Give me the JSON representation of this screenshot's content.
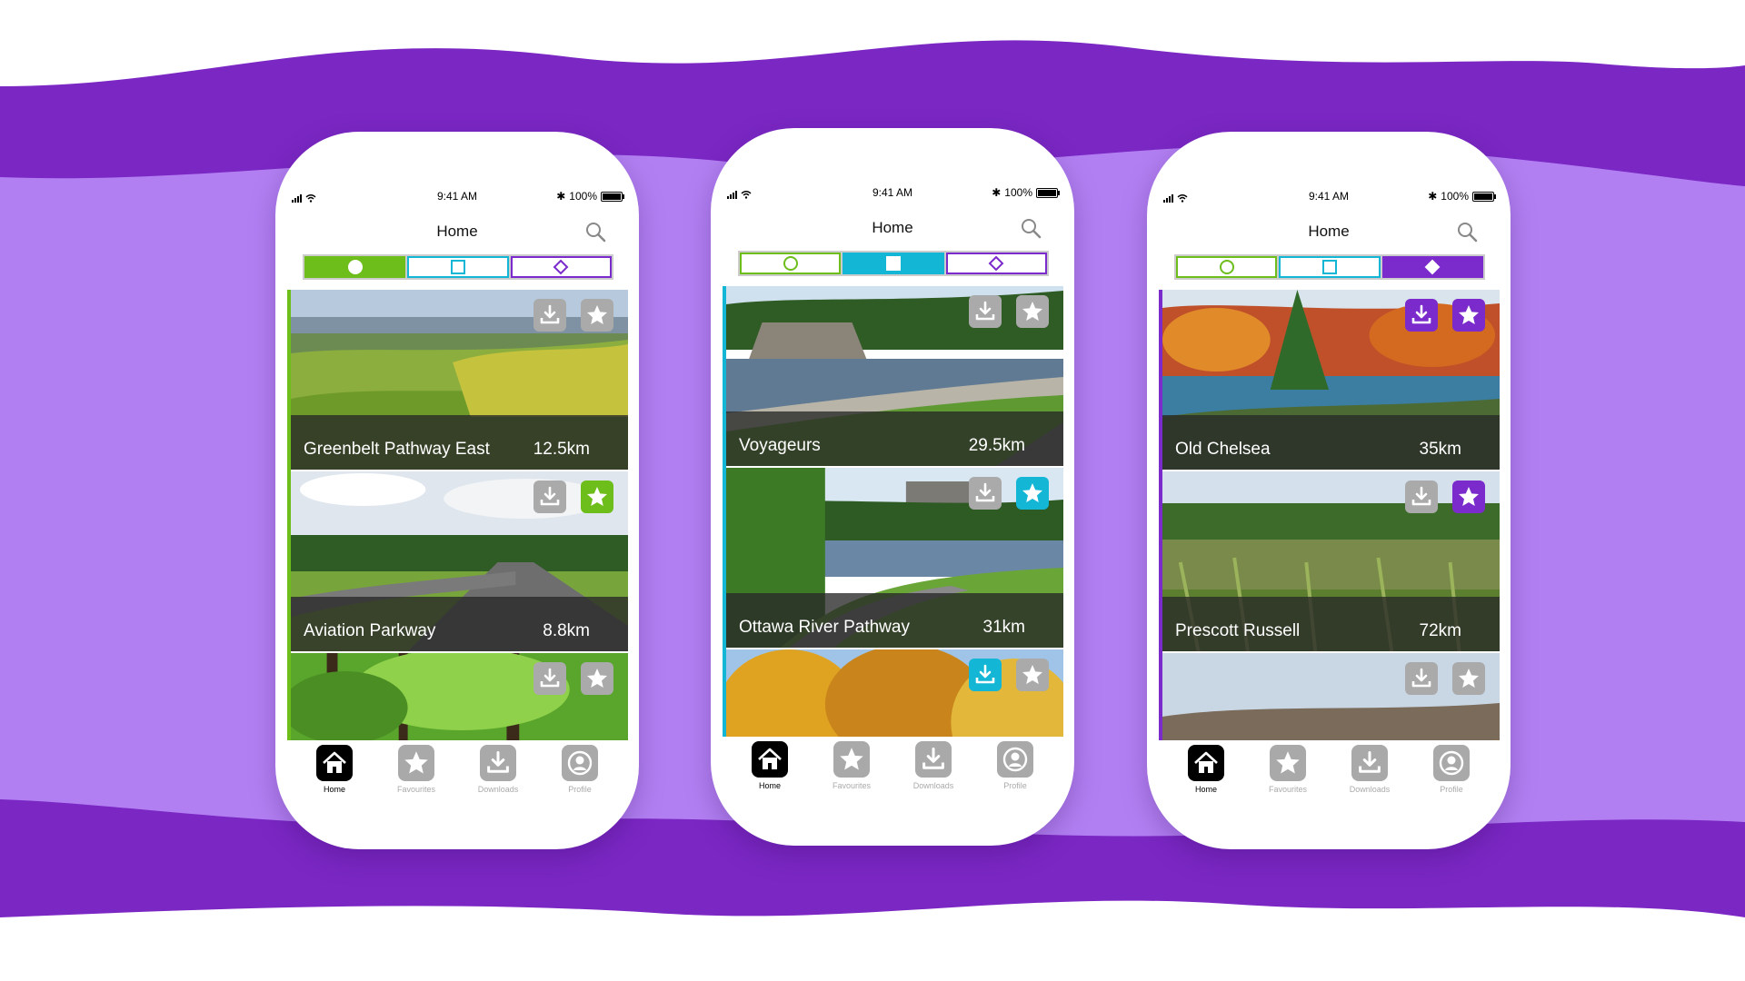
{
  "colors": {
    "bg_dark": "#7b27c4",
    "bg_light": "#b27ff2",
    "green": "#6dbd1b",
    "cyan": "#14b6d6",
    "purple": "#7b2bcc",
    "button_gray": "#aaaaaa"
  },
  "phones": [
    {
      "status": {
        "time": "9:41 AM",
        "battery": "100%"
      },
      "header": {
        "title": "Home",
        "search_icon": "search-icon"
      },
      "segments": [
        {
          "icon": "circle-icon",
          "active": true
        },
        {
          "icon": "square-icon",
          "active": false
        },
        {
          "icon": "diamond-icon",
          "active": false
        }
      ],
      "accent": "#6dbd1b",
      "cards": [
        {
          "name": "Greenbelt Pathway East",
          "distance": "12.5km",
          "downloaded": false,
          "favourite": false,
          "photo": "meadow-river"
        },
        {
          "name": "Aviation Parkway",
          "distance": "8.8km",
          "downloaded": false,
          "favourite": true,
          "photo": "parkway-road"
        },
        {
          "name": "",
          "distance": "",
          "downloaded": false,
          "favourite": false,
          "photo": "green-forest"
        }
      ],
      "tabs": [
        {
          "label": "Home",
          "icon": "home-icon",
          "active": true
        },
        {
          "label": "Favourites",
          "icon": "star-icon",
          "active": false
        },
        {
          "label": "Downloads",
          "icon": "download-icon",
          "active": false
        },
        {
          "label": "Profile",
          "icon": "profile-icon",
          "active": false
        }
      ]
    },
    {
      "status": {
        "time": "9:41 AM",
        "battery": "100%"
      },
      "header": {
        "title": "Home",
        "search_icon": "search-icon"
      },
      "segments": [
        {
          "icon": "circle-icon",
          "active": false
        },
        {
          "icon": "square-icon",
          "active": true
        },
        {
          "icon": "diamond-icon",
          "active": false
        }
      ],
      "accent": "#14b6d6",
      "cards": [
        {
          "name": "Voyageurs",
          "distance": "29.5km",
          "downloaded": false,
          "favourite": false,
          "photo": "river-rocks"
        },
        {
          "name": "Ottawa River Pathway",
          "distance": "31km",
          "downloaded": false,
          "favourite": true,
          "photo": "river-path"
        },
        {
          "name": "",
          "distance": "",
          "downloaded": true,
          "favourite": false,
          "photo": "autumn-trees"
        }
      ],
      "tabs": [
        {
          "label": "Home",
          "icon": "home-icon",
          "active": true
        },
        {
          "label": "Favourites",
          "icon": "star-icon",
          "active": false
        },
        {
          "label": "Downloads",
          "icon": "download-icon",
          "active": false
        },
        {
          "label": "Profile",
          "icon": "profile-icon",
          "active": false
        }
      ]
    },
    {
      "status": {
        "time": "9:41 AM",
        "battery": "100%"
      },
      "header": {
        "title": "Home",
        "search_icon": "search-icon"
      },
      "segments": [
        {
          "icon": "circle-icon",
          "active": false
        },
        {
          "icon": "square-icon",
          "active": false
        },
        {
          "icon": "diamond-icon",
          "active": true
        }
      ],
      "accent": "#7b2bcc",
      "cards": [
        {
          "name": "Old Chelsea",
          "distance": "35km",
          "downloaded": true,
          "favourite": true,
          "photo": "autumn-lake"
        },
        {
          "name": "Prescott Russell",
          "distance": "72km",
          "downloaded": false,
          "favourite": true,
          "photo": "marsh"
        },
        {
          "name": "",
          "distance": "",
          "downloaded": false,
          "favourite": false,
          "photo": "hills-view"
        }
      ],
      "tabs": [
        {
          "label": "Home",
          "icon": "home-icon",
          "active": true
        },
        {
          "label": "Favourites",
          "icon": "star-icon",
          "active": false
        },
        {
          "label": "Downloads",
          "icon": "download-icon",
          "active": false
        },
        {
          "label": "Profile",
          "icon": "profile-icon",
          "active": false
        }
      ]
    }
  ]
}
